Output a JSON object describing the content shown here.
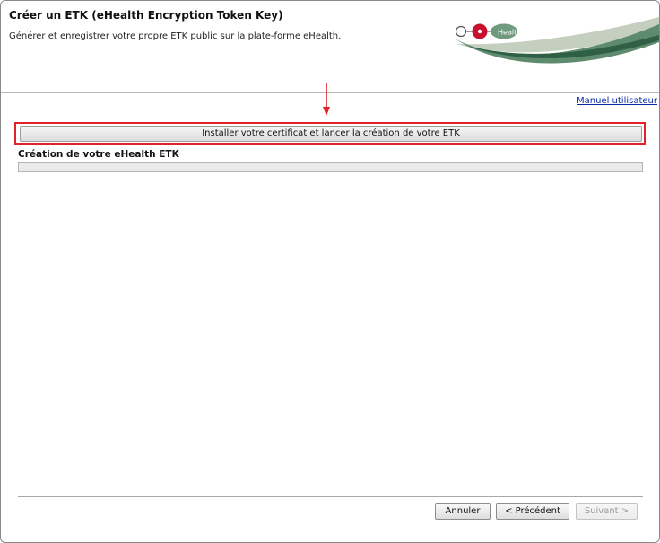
{
  "header": {
    "title": "Créer un ETK (eHealth Encryption Token Key)",
    "subtitle": "Générer et enregistrer votre propre ETK public sur la plate-forme eHealth.",
    "logo_text": "Health"
  },
  "links": {
    "manual": "Manuel utilisateur"
  },
  "main": {
    "install_button": "Installer votre certificat et lancer la création de votre ETK",
    "section_title": "Création de votre eHealth ETK",
    "progress_percent": 0
  },
  "footer": {
    "cancel": "Annuler",
    "previous": "< Précédent",
    "next": "Suivant >"
  },
  "colors": {
    "highlight": "#e0222a",
    "link": "#0b2aa8",
    "brand_green": "#5e8a6d",
    "brand_red": "#c8102e"
  }
}
